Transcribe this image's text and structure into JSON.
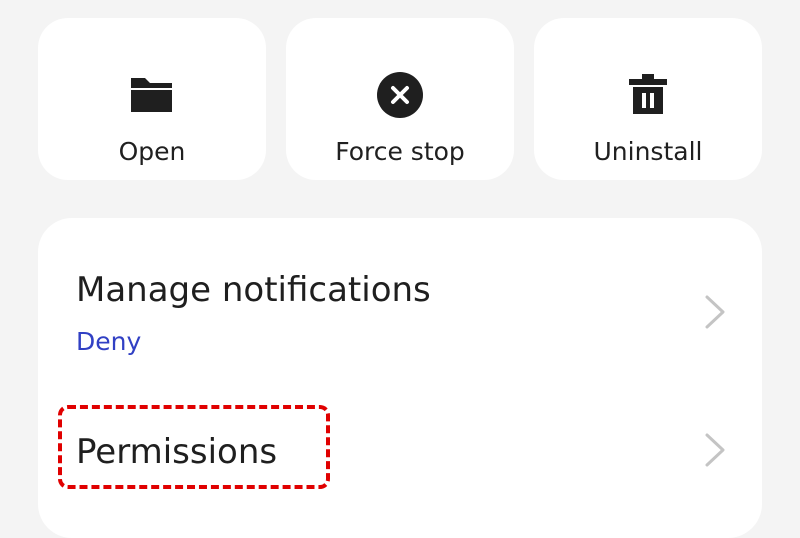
{
  "actions": [
    {
      "label": "Open",
      "icon": "folder-icon"
    },
    {
      "label": "Force stop",
      "icon": "close-circle-icon"
    },
    {
      "label": "Uninstall",
      "icon": "trash-icon"
    }
  ],
  "settings": {
    "notifications": {
      "title": "Manage notifications",
      "subtitle": "Deny"
    },
    "permissions": {
      "title": "Permissions"
    }
  },
  "colors": {
    "background": "#f4f4f4",
    "card": "#ffffff",
    "text": "#1f1f1f",
    "accent": "#3140c4",
    "highlight": "#e00000",
    "chevron": "#c4c4c4"
  }
}
